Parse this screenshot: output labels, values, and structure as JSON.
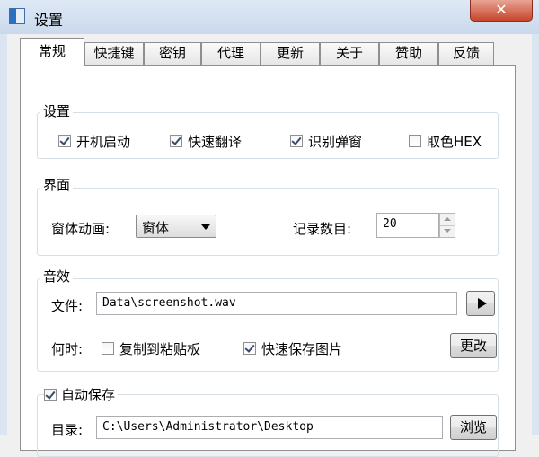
{
  "window": {
    "title": "设置",
    "close_label": "✕"
  },
  "tabs": [
    {
      "label": "常规",
      "active": true
    },
    {
      "label": "快捷键"
    },
    {
      "label": "密钥"
    },
    {
      "label": "代理"
    },
    {
      "label": "更新"
    },
    {
      "label": "关于"
    },
    {
      "label": "赞助"
    },
    {
      "label": "反馈"
    }
  ],
  "settings": {
    "title": "设置",
    "startup": {
      "label": "开机启动",
      "checked": true
    },
    "quick_translate": {
      "label": "快速翻译",
      "checked": true
    },
    "recognize_popup": {
      "label": "识别弹窗",
      "checked": true
    },
    "pick_color_hex": {
      "label": "取色HEX",
      "checked": false
    }
  },
  "interface": {
    "title": "界面",
    "animation_label": "窗体动画:",
    "animation_value": "窗体",
    "record_count_label": "记录数目:",
    "record_count_value": "20"
  },
  "sound": {
    "title": "音效",
    "file_label": "文件:",
    "file_value": "Data\\screenshot.wav",
    "when_label": "何时:",
    "copy_clipboard": {
      "label": "复制到粘贴板",
      "checked": false
    },
    "quick_save_image": {
      "label": "快速保存图片",
      "checked": true
    },
    "change_label": "更改"
  },
  "autosave": {
    "title": "自动保存",
    "checked": true,
    "dir_label": "目录:",
    "dir_value": "C:\\Users\\Administrator\\Desktop",
    "browse_label": "浏览"
  }
}
